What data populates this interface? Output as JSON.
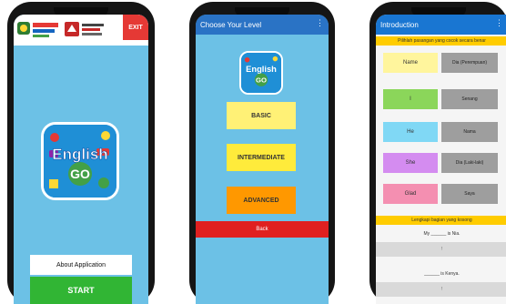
{
  "phone1": {
    "exit_label": "EXIT",
    "app_name_line1": "English",
    "app_name_line2": "GO",
    "about_label": "About Application",
    "start_label": "START"
  },
  "phone2": {
    "title": "Choose Your Level",
    "app_name_line1": "English",
    "app_name_line2": "GO",
    "levels": [
      {
        "label": "BASIC",
        "color": "#fff176"
      },
      {
        "label": "INTERMEDIATE",
        "color": "#ffeb3b"
      },
      {
        "label": "ADVANCED",
        "color": "#ff9800"
      }
    ],
    "back_label": "Back"
  },
  "phone3": {
    "title": "Introduction",
    "banner1": "Pilihlah pasangan yang cocok secara benar",
    "pairs": [
      {
        "left": "Name",
        "right": "Dia (Perempuan)",
        "color": "#fff59d"
      },
      {
        "left": "I",
        "right": "Senang",
        "color": "#8bd65a"
      },
      {
        "left": "He",
        "right": "Nama",
        "color": "#80d8f5"
      },
      {
        "left": "She",
        "right": "Dia (Laki-laki)",
        "color": "#d48cf0"
      },
      {
        "left": "Glad",
        "right": "Saya",
        "color": "#f48fb1"
      }
    ],
    "banner2": "Lengkapi bagian yang kosong",
    "sentence1": "My ______ is Nia.",
    "answer1": "!",
    "sentence2": "______ is Kenya.",
    "answer2": "!"
  }
}
